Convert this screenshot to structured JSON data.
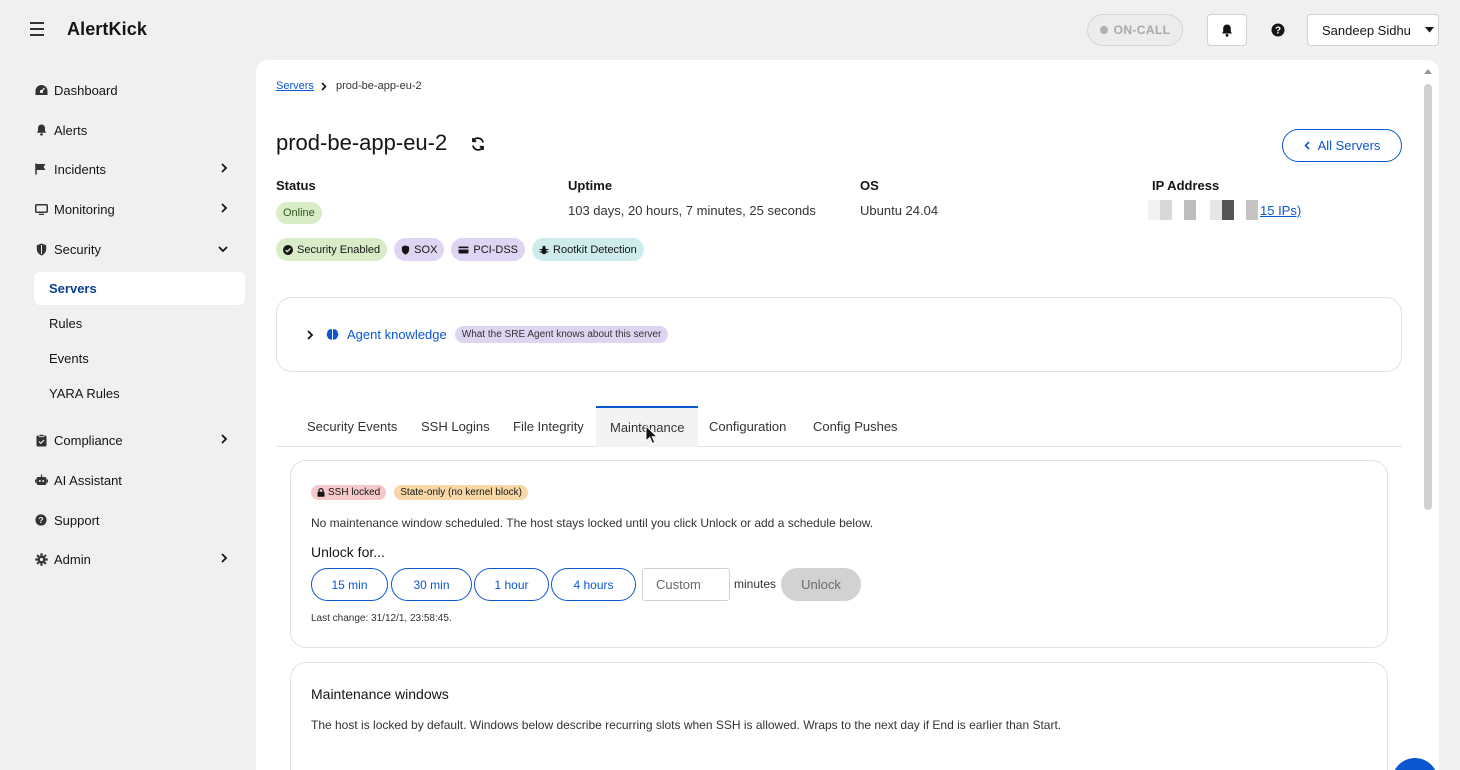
{
  "app": {
    "name": "AlertKick"
  },
  "topbar": {
    "oncall_label": "ON-CALL",
    "user_name": "Sandeep Sidhu"
  },
  "sidebar": {
    "items": [
      {
        "label": "Dashboard",
        "icon": "dashboard-icon"
      },
      {
        "label": "Alerts",
        "icon": "bell-icon"
      },
      {
        "label": "Incidents",
        "icon": "flag-icon"
      },
      {
        "label": "Monitoring",
        "icon": "monitor-icon"
      },
      {
        "label": "Security",
        "icon": "shield-icon"
      },
      {
        "label": "Compliance",
        "icon": "clipboard-icon"
      },
      {
        "label": "AI Assistant",
        "icon": "robot-icon"
      },
      {
        "label": "Support",
        "icon": "help-icon"
      },
      {
        "label": "Admin",
        "icon": "gear-icon"
      }
    ],
    "security_sub": [
      "Servers",
      "Rules",
      "Events",
      "YARA Rules"
    ]
  },
  "breadcrumb": {
    "parent": "Servers",
    "current": "prod-be-app-eu-2"
  },
  "server": {
    "title": "prod-be-app-eu-2",
    "all_servers_label": "All Servers",
    "status_label": "Status",
    "status_value": "Online",
    "uptime_label": "Uptime",
    "uptime_value": "103 days, 20 hours, 7 minutes, 25 seconds",
    "os_label": "OS",
    "os_value": "Ubuntu 24.04",
    "ip_label": "IP Address",
    "ip_link": "15 IPs)"
  },
  "badges": [
    "Security Enabled",
    "SOX",
    "PCI-DSS",
    "Rootkit Detection"
  ],
  "agent": {
    "title": "Agent knowledge",
    "pill": "What the SRE Agent knows about this server"
  },
  "tabs": [
    "Security Events",
    "SSH Logins",
    "File Integrity",
    "Maintenance",
    "Configuration",
    "Config Pushes"
  ],
  "maintenance": {
    "ssh_locked": "SSH locked",
    "state_only": "State-only (no kernel block)",
    "notice": "No maintenance window scheduled. The host stays locked until you click Unlock or add a schedule below.",
    "unlock_for": "Unlock for...",
    "durations": [
      "15 min",
      "30 min",
      "1 hour",
      "4 hours"
    ],
    "custom_placeholder": "Custom",
    "minutes_label": "minutes",
    "unlock_label": "Unlock",
    "last_change": "Last change: 31/12/1, 23:58:45."
  },
  "windows": {
    "title": "Maintenance windows",
    "desc": "The host is locked by default. Windows below describe recurring slots when SSH is allowed. Wraps to the next day if End is earlier than Start."
  },
  "colors": {
    "accent": "#0b57d0",
    "online_bg": "#d8ecc8",
    "purple_bg": "#ddd5f1",
    "teal_bg": "#cdeceb",
    "lock_bg": "#f5c9c9",
    "state_bg": "#f8d7a6"
  }
}
